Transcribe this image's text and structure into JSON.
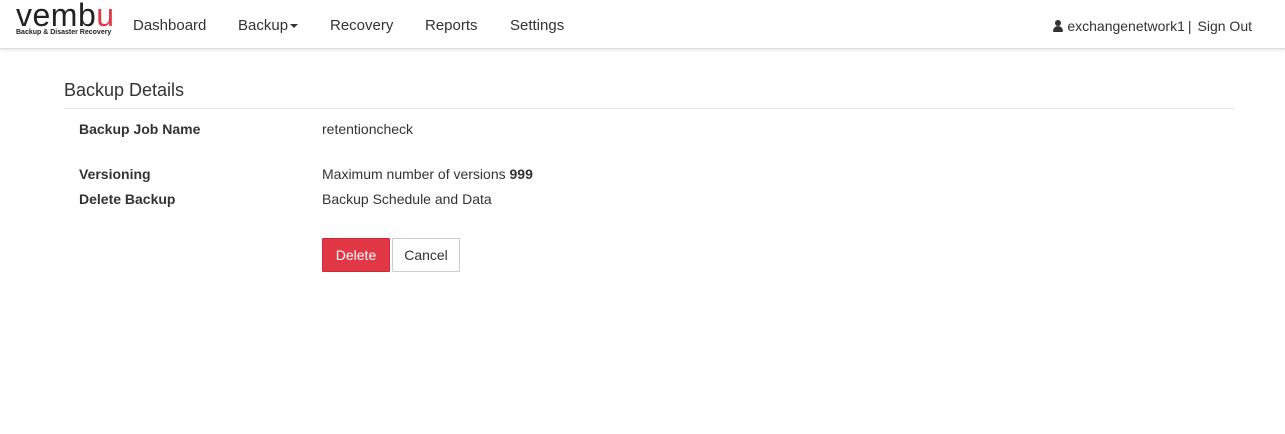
{
  "brand": {
    "logo_word_prefix": "vemb",
    "logo_word_accent": "u",
    "logo_tagline": "Backup & Disaster Recovery",
    "accent_color": "#e23744"
  },
  "nav": {
    "items": [
      {
        "label": "Dashboard"
      },
      {
        "label": "Backup"
      },
      {
        "label": "Recovery"
      },
      {
        "label": "Reports"
      },
      {
        "label": "Settings"
      }
    ],
    "backup_has_dropdown": true
  },
  "user": {
    "icon": "user-icon",
    "username": "exchangenetwork1",
    "separator": "|",
    "signout_label": "Sign Out"
  },
  "details": {
    "title": "Backup Details",
    "job_name_label": "Backup Job Name",
    "job_name_value": "retentioncheck",
    "versioning_label": "Versioning",
    "versioning_text": "Maximum number of versions",
    "versioning_count": "999",
    "delete_label": "Delete Backup",
    "delete_value": "Backup Schedule and Data"
  },
  "actions": {
    "delete_label": "Delete",
    "delete_color": "#e23744",
    "cancel_label": "Cancel"
  }
}
